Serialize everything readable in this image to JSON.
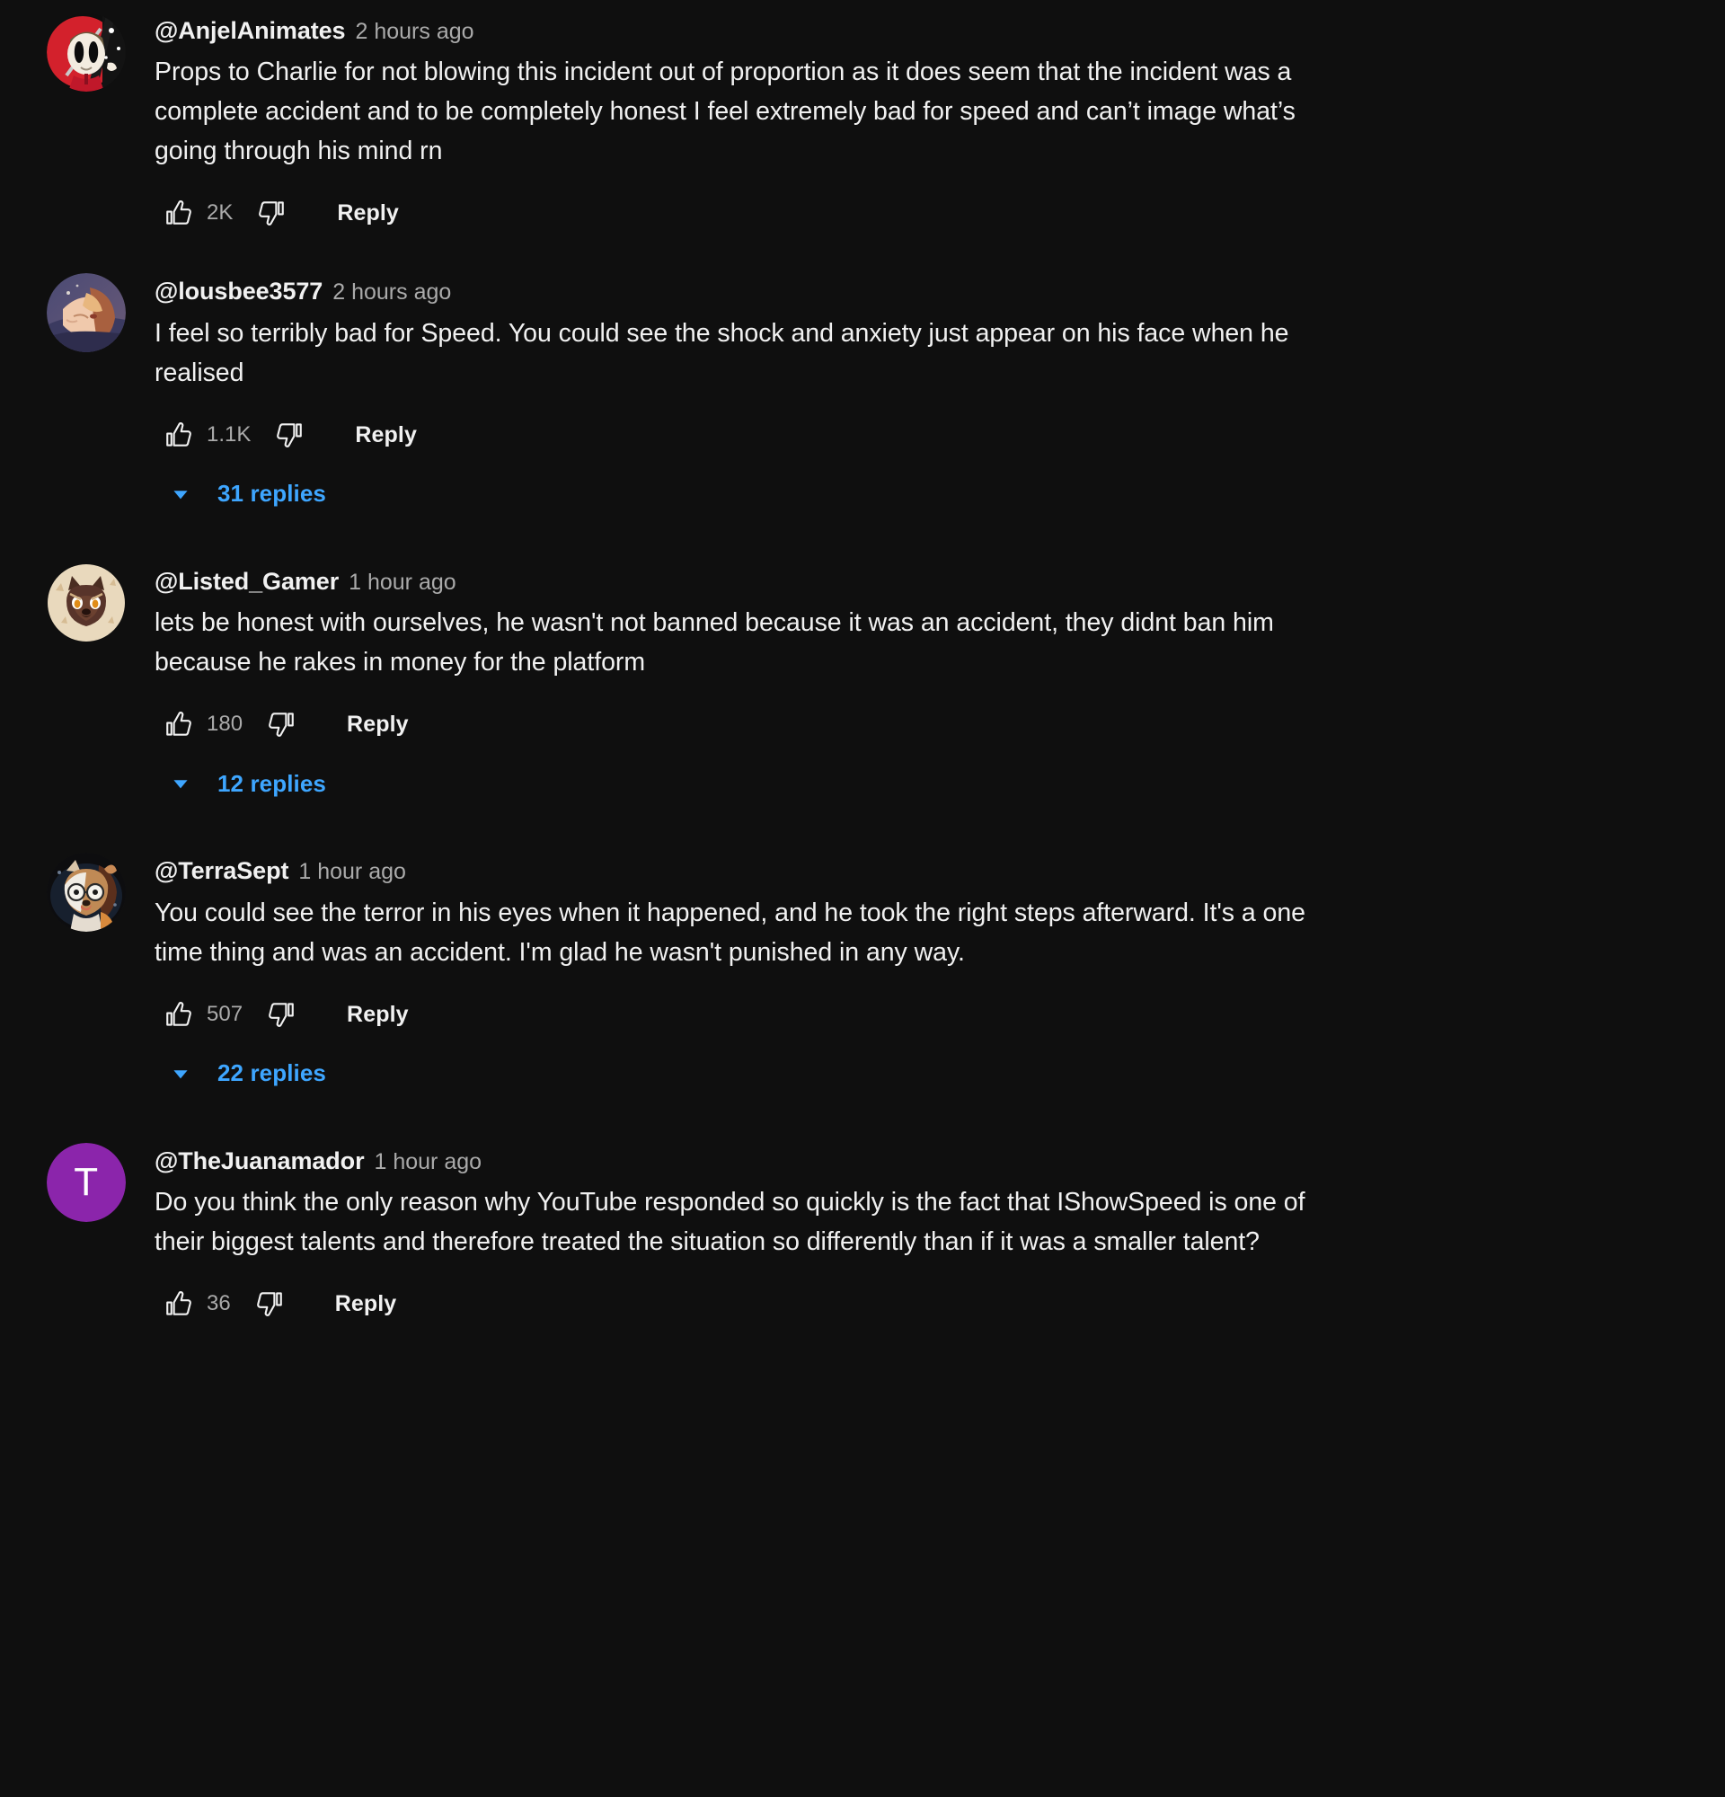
{
  "theme": {
    "background": "#0f0f0f",
    "text_primary": "#f1f1f1",
    "text_secondary": "#aaaaaa",
    "accent_blue": "#3ea6ff"
  },
  "labels": {
    "reply": "Reply"
  },
  "comments": [
    {
      "author": "@AnjelAnimates",
      "timestamp": "2 hours ago",
      "text": "Props to Charlie for not blowing this incident out of proportion as it does seem that the incident was a complete accident and to be completely honest I feel extremely bad for speed and can’t image what’s going through his mind rn",
      "likes": "2K",
      "reply_label": "Reply",
      "replies_label": null,
      "avatar": {
        "type": "image",
        "kind": "anjel",
        "color": "#d3212c"
      }
    },
    {
      "author": "@lousbee3577",
      "timestamp": "2 hours ago",
      "text": "I feel so terribly bad for Speed. You could see the shock and anxiety just appear on his face when he realised",
      "likes": "1.1K",
      "reply_label": "Reply",
      "replies_label": "31 replies",
      "avatar": {
        "type": "image",
        "kind": "lousbee",
        "color": "#4b4a6b"
      }
    },
    {
      "author": "@Listed_Gamer",
      "timestamp": "1 hour ago",
      "text": "lets be honest with ourselves, he wasn't not banned because it was an accident, they didnt ban him because he rakes in money for the platform",
      "likes": "180",
      "reply_label": "Reply",
      "replies_label": "12 replies",
      "avatar": {
        "type": "image",
        "kind": "listed",
        "color": "#e8d5b8"
      }
    },
    {
      "author": "@TerraSept",
      "timestamp": "1 hour ago",
      "text": "You could see the terror in his eyes when it happened, and he took the right steps afterward. It's a one time thing and was an accident. I'm glad he wasn't punished in any way.",
      "likes": "507",
      "reply_label": "Reply",
      "replies_label": "22 replies",
      "avatar": {
        "type": "image",
        "kind": "terra",
        "color": "#2a2f3a"
      }
    },
    {
      "author": "@TheJuanamador",
      "timestamp": "1 hour ago",
      "text": "Do you think the only reason why YouTube responded so quickly is the fact that IShowSpeed is one of their biggest talents and therefore treated the situation so differently than if it was a smaller talent?",
      "likes": "36",
      "reply_label": "Reply",
      "replies_label": null,
      "avatar": {
        "type": "letter",
        "kind": "letter",
        "letter": "T",
        "color": "#8b25ab"
      }
    }
  ]
}
